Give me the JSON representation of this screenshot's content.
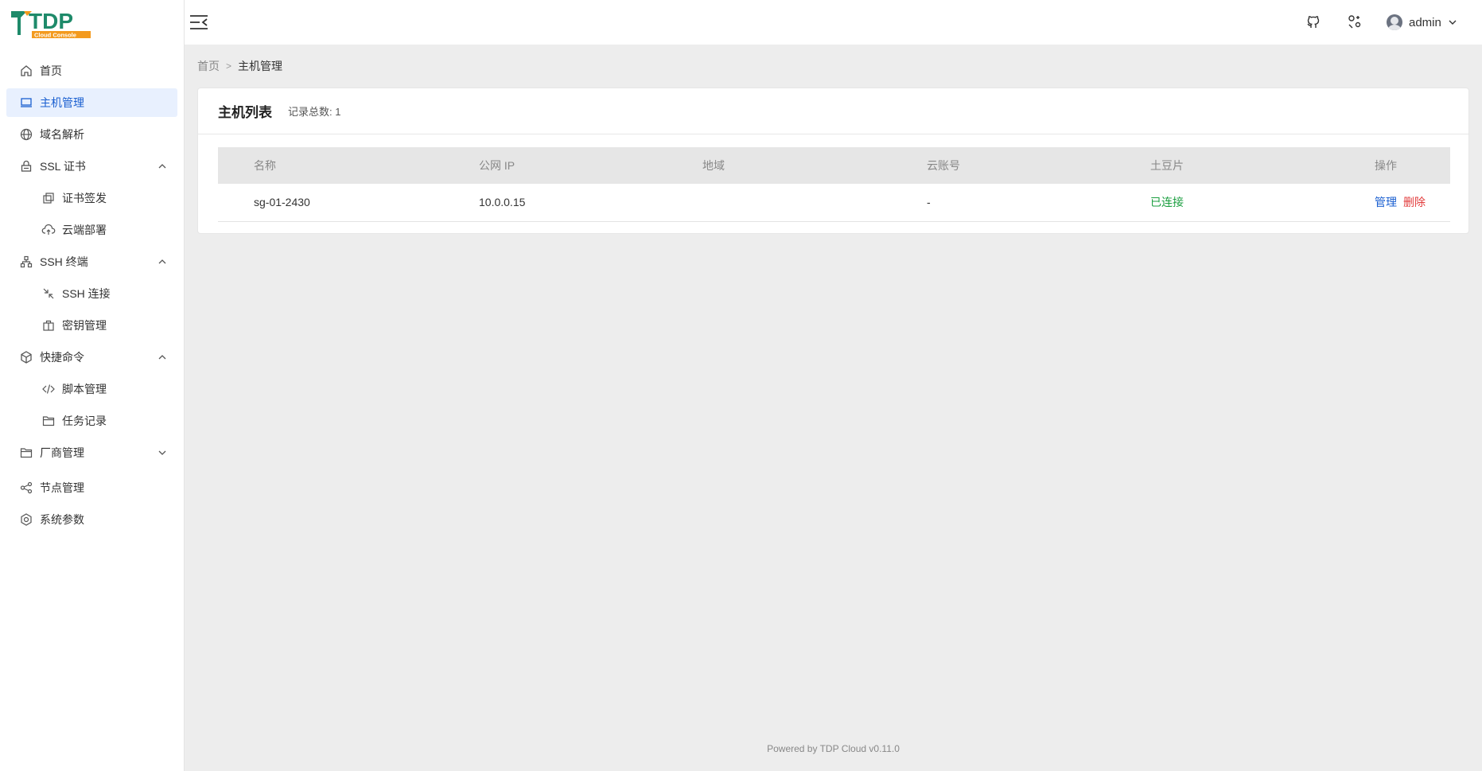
{
  "logo": {
    "letters": "TDP",
    "tagline": "Cloud Console"
  },
  "sidebar": {
    "items": [
      {
        "label": "首页",
        "icon": "home-icon"
      },
      {
        "label": "主机管理",
        "icon": "monitor-icon",
        "active": true
      },
      {
        "label": "域名解析",
        "icon": "globe-icon"
      },
      {
        "label": "SSL 证书",
        "icon": "lock-icon",
        "expanded": true
      },
      {
        "label": "证书签发",
        "icon": "copy-icon"
      },
      {
        "label": "云端部署",
        "icon": "cloud-upload-icon"
      },
      {
        "label": "SSH 终端",
        "icon": "network-icon",
        "expanded": true
      },
      {
        "label": "SSH 连接",
        "icon": "arrows-icon"
      },
      {
        "label": "密钥管理",
        "icon": "briefcase-icon"
      },
      {
        "label": "快捷命令",
        "icon": "cube-icon",
        "expanded": true
      },
      {
        "label": "脚本管理",
        "icon": "code-icon"
      },
      {
        "label": "任务记录",
        "icon": "folder-icon"
      },
      {
        "label": "厂商管理",
        "icon": "folder-icon",
        "expanded": false
      },
      {
        "label": "节点管理",
        "icon": "share-icon"
      },
      {
        "label": "系统参数",
        "icon": "settings-icon"
      }
    ]
  },
  "header": {
    "username": "admin"
  },
  "breadcrumb": {
    "home": "首页",
    "current": "主机管理"
  },
  "card": {
    "title": "主机列表",
    "count_label": "记录总数: 1"
  },
  "table": {
    "columns": [
      "名称",
      "公网 IP",
      "地域",
      "云账号",
      "土豆片",
      "操作"
    ],
    "rows": [
      {
        "name": "sg-01-2430",
        "ip": "10.0.0.15",
        "region": "",
        "account": "-",
        "status": "已连接",
        "action_manage": "管理",
        "action_delete": "删除"
      }
    ]
  },
  "footer": {
    "text": "Powered by TDP Cloud v0.11.0"
  },
  "colors": {
    "accent": "#1a5fd0",
    "active_bg": "#e8f0fe",
    "success": "#1a9e3f",
    "danger": "#e23c3c",
    "logo_teal": "#1e8a6a",
    "logo_orange": "#f39a1e"
  }
}
